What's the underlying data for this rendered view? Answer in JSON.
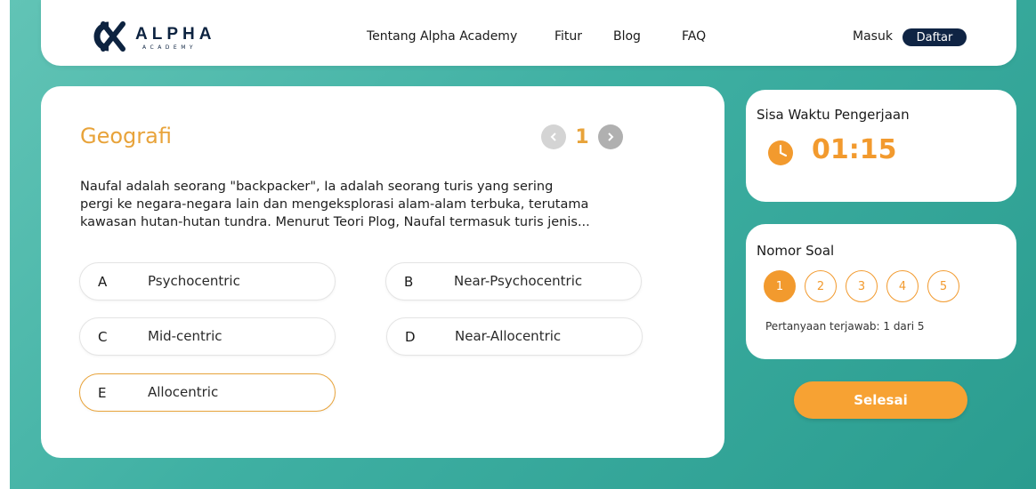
{
  "brand": {
    "name": "ALPHA",
    "subname": "ACADEMY",
    "navy": "#0f2444",
    "orange": "#f29a2e"
  },
  "nav": {
    "links": [
      "Tentang Alpha Academy",
      "Fitur",
      "Blog",
      "FAQ"
    ],
    "login": "Masuk",
    "register": "Daftar"
  },
  "question": {
    "subject": "Geografi",
    "current_number": "1",
    "prev_icon": "chevron-left-icon",
    "next_icon": "chevron-right-icon",
    "lines": [
      "Naufal adalah seorang \"backpacker\", Ia adalah seorang turis yang sering",
      "pergi ke negara-negara lain dan mengeksplorasi alam-alam terbuka, terutama",
      "kawasan hutan-hutan tundra. Menurut Teori Plog, Naufal termasuk turis jenis..."
    ],
    "options": [
      {
        "letter": "A",
        "text": "Psychocentric"
      },
      {
        "letter": "B",
        "text": "Near-Psychocentric"
      },
      {
        "letter": "C",
        "text": "Mid-centric"
      },
      {
        "letter": "D",
        "text": "Near-Allocentric"
      },
      {
        "letter": "E",
        "text": "Allocentric"
      }
    ],
    "selected_option": "E"
  },
  "timer": {
    "label": "Sisa Waktu Pengerjaan",
    "value": "01:15",
    "icon": "clock-icon"
  },
  "nomor_soal": {
    "label": "Nomor Soal",
    "numbers": [
      "1",
      "2",
      "3",
      "4",
      "5"
    ],
    "active": "1",
    "answered_text": "Pertanyaan terjawab: 1 dari 5"
  },
  "finish_label": "Selesai"
}
